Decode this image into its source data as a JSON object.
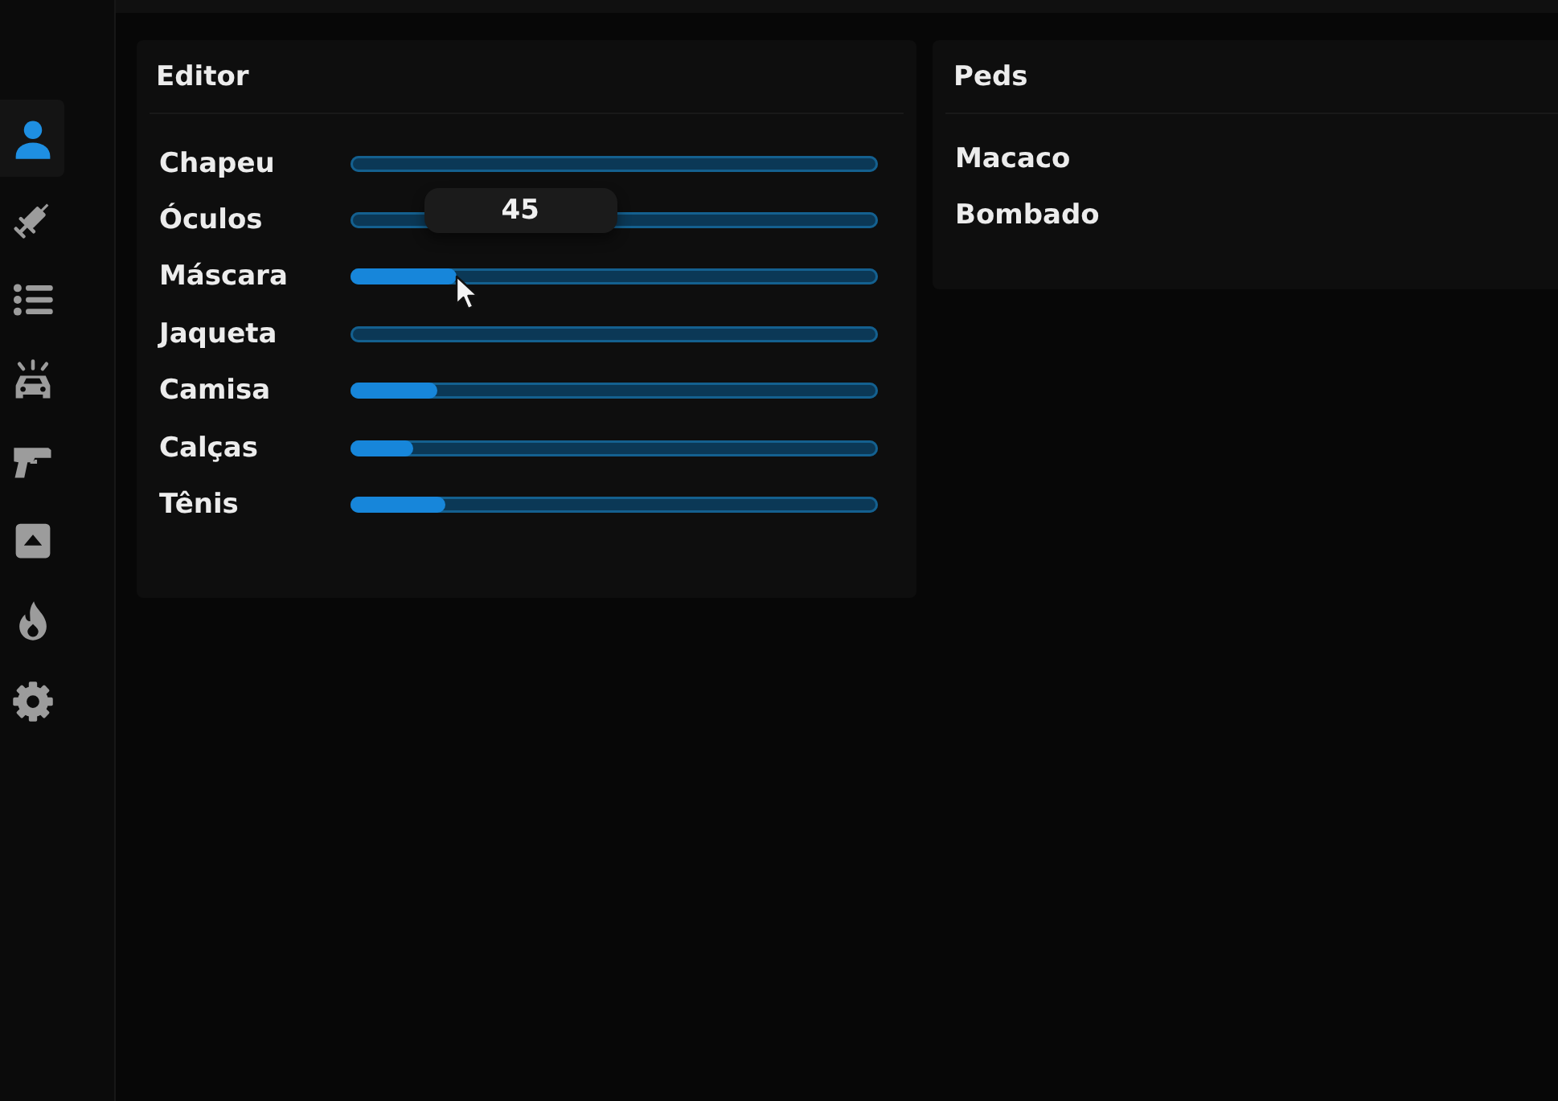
{
  "sidebar": {
    "items": [
      {
        "kind": "person",
        "selected": true
      },
      {
        "kind": "syringe",
        "selected": false
      },
      {
        "kind": "list",
        "selected": false
      },
      {
        "kind": "car",
        "selected": false
      },
      {
        "kind": "pistol",
        "selected": false
      },
      {
        "kind": "caret_box",
        "selected": false
      },
      {
        "kind": "flame",
        "selected": false
      },
      {
        "kind": "gear",
        "selected": false
      }
    ]
  },
  "editor": {
    "title": "Editor",
    "sliders": [
      {
        "label": "Chapeu",
        "level": 0
      },
      {
        "label": "Óculos",
        "level": 0
      },
      {
        "label": "Máscara",
        "level": 0.2,
        "tooltip": "45"
      },
      {
        "label": "Jaqueta",
        "level": 0
      },
      {
        "label": "Camisa",
        "level": 0.165
      },
      {
        "label": "Calças",
        "level": 0.12
      },
      {
        "label": "Tênis",
        "level": 0.18
      }
    ]
  },
  "peds": {
    "title": "Peds",
    "items": [
      "Macaco",
      "Bombado"
    ]
  }
}
